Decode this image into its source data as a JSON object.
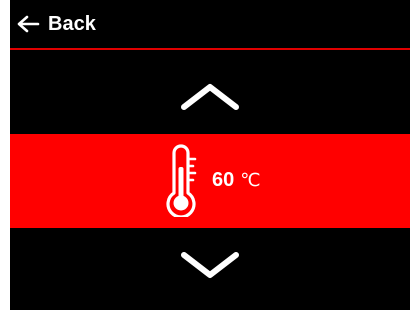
{
  "header": {
    "back_label": "Back"
  },
  "setpoint": {
    "value": "60",
    "unit": "℃"
  },
  "colors": {
    "background": "#000000",
    "accent": "#ff0000",
    "text": "#ffffff"
  },
  "icons": {
    "back": "arrow-left-icon",
    "increase": "chevron-up-icon",
    "decrease": "chevron-down-icon",
    "temperature": "thermometer-icon"
  }
}
